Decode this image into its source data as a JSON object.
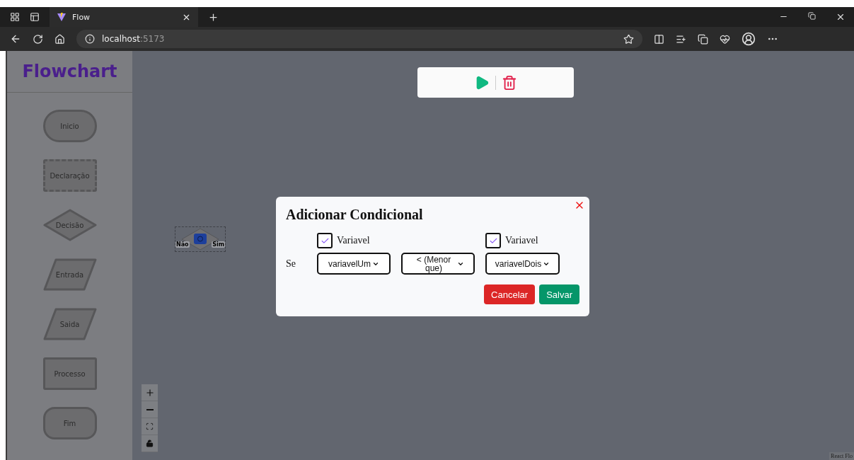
{
  "browser": {
    "tab_title": "Flow",
    "address": {
      "host": "localhost",
      "port": ":5173"
    }
  },
  "sidebar": {
    "title": "Flowchart",
    "shapes": [
      {
        "label": "Inicio",
        "kind": "terminal"
      },
      {
        "label": "Declaração",
        "kind": "declaration"
      },
      {
        "label": "Decisão",
        "kind": "decision"
      },
      {
        "label": "Entrada",
        "kind": "io"
      },
      {
        "label": "Saida",
        "kind": "io"
      },
      {
        "label": "Processo",
        "kind": "process"
      },
      {
        "label": "Fim",
        "kind": "end"
      }
    ]
  },
  "canvas": {
    "node": {
      "left_label": "Não",
      "right_label": "Sim"
    },
    "attribution": "React Flo"
  },
  "dialog": {
    "title": "Adicionar Condicional",
    "condition_label": "Se",
    "operands": [
      {
        "kind": "variable",
        "checkbox": {
          "label": "Variavel",
          "checked": true
        },
        "value": "variavelUm"
      },
      {
        "kind": "operator",
        "value": "< (Menor que)"
      },
      {
        "kind": "variable",
        "checkbox": {
          "label": "Variavel",
          "checked": true
        },
        "value": "variavelDois"
      }
    ],
    "buttons": [
      {
        "label": "Cancelar",
        "kind": "cancel"
      },
      {
        "label": "Salvar",
        "kind": "save"
      }
    ]
  }
}
